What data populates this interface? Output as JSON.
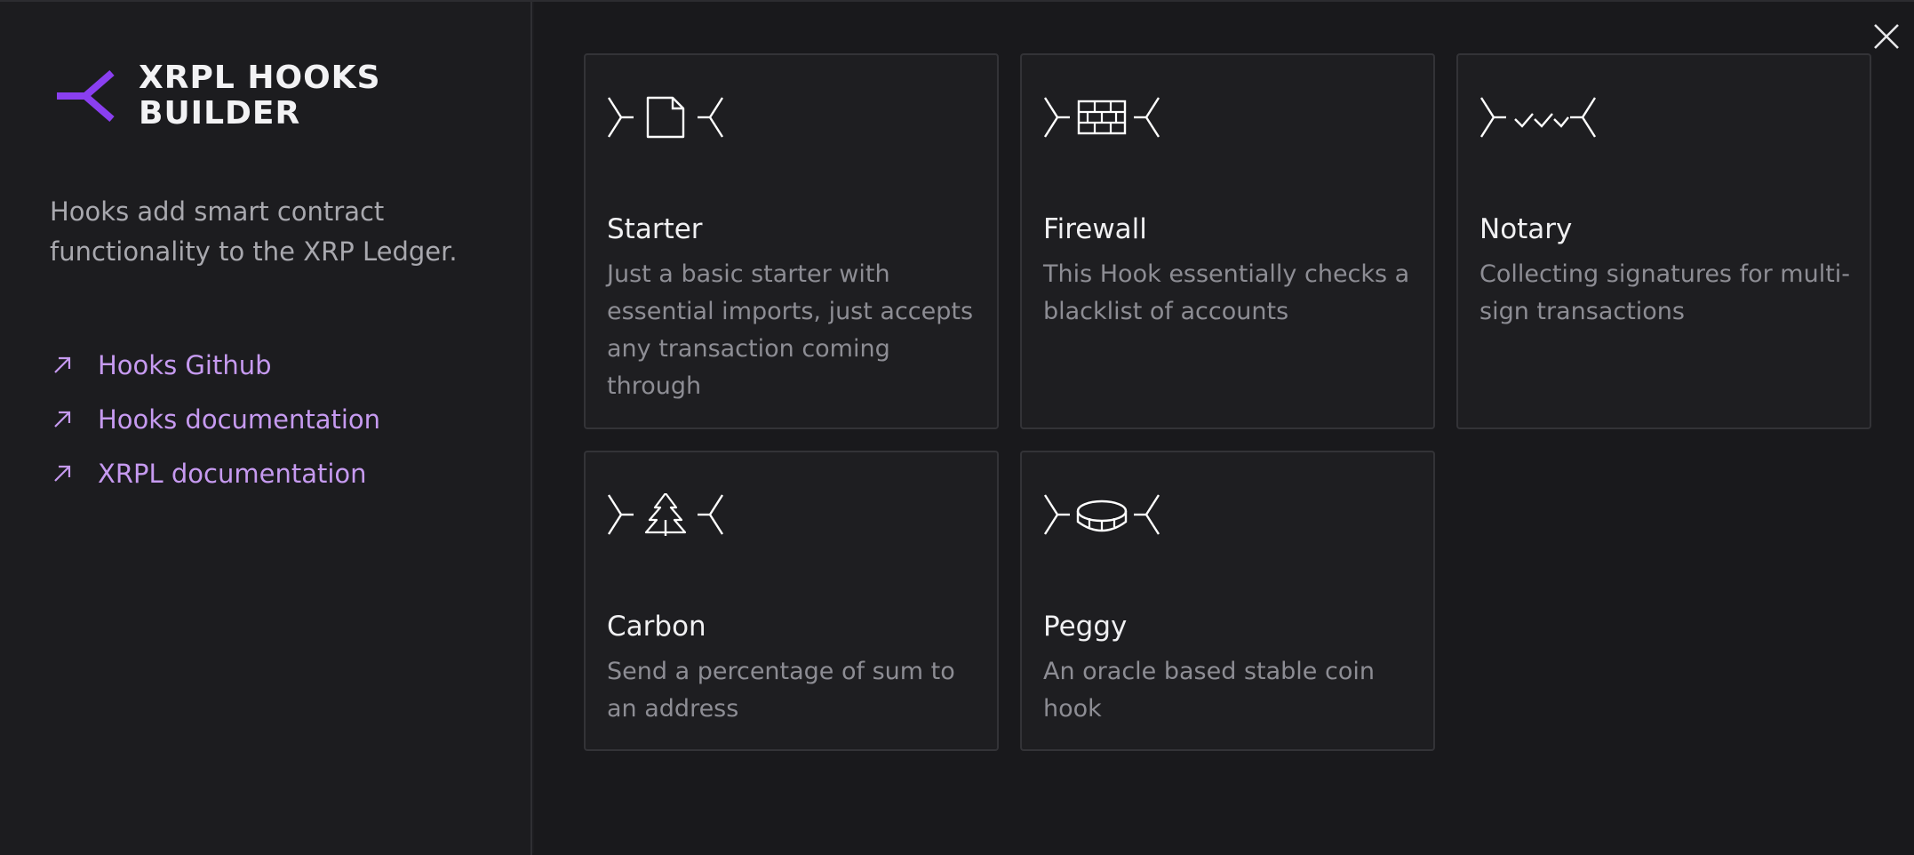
{
  "brand": {
    "title": "XRPL HOOKS BUILDER",
    "accent": "#8a3ff0"
  },
  "sidebar": {
    "tagline": "Hooks add smart contract functionality to the XRP Ledger.",
    "links": [
      {
        "label": "Hooks Github",
        "icon": "arrow-up-right-icon"
      },
      {
        "label": "Hooks documentation",
        "icon": "arrow-up-right-icon"
      },
      {
        "label": "XRPL documentation",
        "icon": "arrow-up-right-icon"
      }
    ],
    "link_color": "#c69af0"
  },
  "templates": [
    {
      "title": "Starter",
      "description": "Just a basic starter with essential imports, just accepts any transaction coming through",
      "icon": "document-icon"
    },
    {
      "title": "Firewall",
      "description": "This Hook essentially checks a blacklist of accounts",
      "icon": "firewall-icon"
    },
    {
      "title": "Notary",
      "description": "Collecting signatures for multi-sign transactions",
      "icon": "checkmarks-icon"
    },
    {
      "title": "Carbon",
      "description": "Send a percentage of sum to an address",
      "icon": "tree-icon"
    },
    {
      "title": "Peggy",
      "description": "An oracle based stable coin hook",
      "icon": "coin-icon"
    }
  ],
  "close": {
    "icon": "close-icon"
  }
}
